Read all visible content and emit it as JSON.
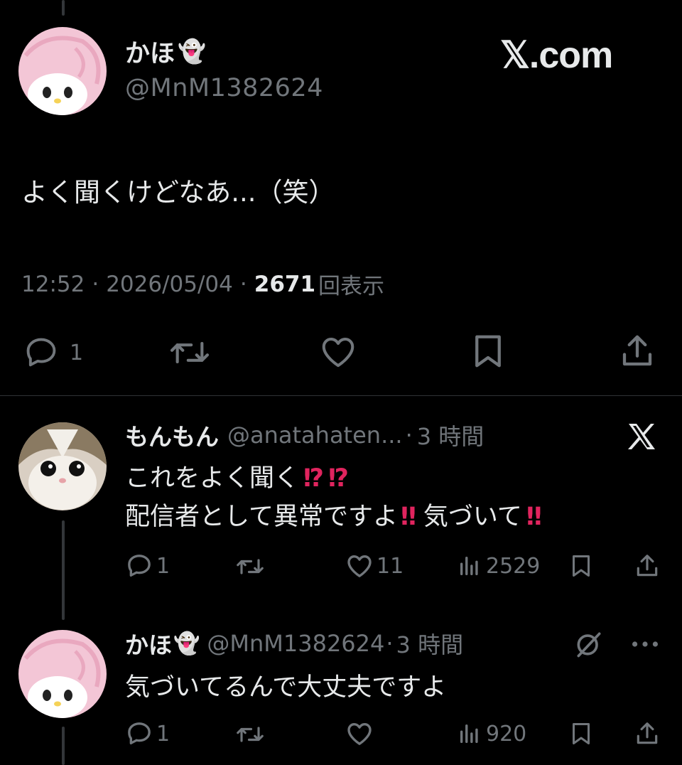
{
  "main_post": {
    "display_name": "かほ",
    "name_emoji": "👻",
    "handle": "@MnM1382624",
    "watermark": "𝕏.com",
    "text": "よく聞くけどなあ...（笑）",
    "time": "12:52",
    "sep1": "·",
    "date": "2026/05/04",
    "sep2": "·",
    "views_count": "2671",
    "views_label": "回表示",
    "actions": {
      "reply_count": "1",
      "retweet_count": "",
      "like_count": ""
    }
  },
  "replies": [
    {
      "display_name": "もんもん",
      "handle": "@anatahaten...",
      "sep": "·",
      "time_ago": "3 時間",
      "line1_text": "これをよく聞く",
      "line1_emoji": "⁉⁉",
      "line2_text_a": "配信者として異常ですよ",
      "line2_emoji_a": "‼",
      "line2_text_b": "気づいて",
      "line2_emoji_b": "‼",
      "reply_count": "1",
      "like_count": "11",
      "views": "2529"
    },
    {
      "display_name": "かほ",
      "name_emoji": "👻",
      "handle": "@MnM1382624",
      "sep": "·",
      "time_ago": "3 時間",
      "text": "気づいてるんで大丈夫ですよ",
      "reply_count": "1",
      "views": "920"
    }
  ],
  "colors": {
    "background": "#000000",
    "text": "#e7e9ea",
    "muted": "#71767b",
    "divider": "#2f3336",
    "emoji_red": "#e0245e"
  }
}
